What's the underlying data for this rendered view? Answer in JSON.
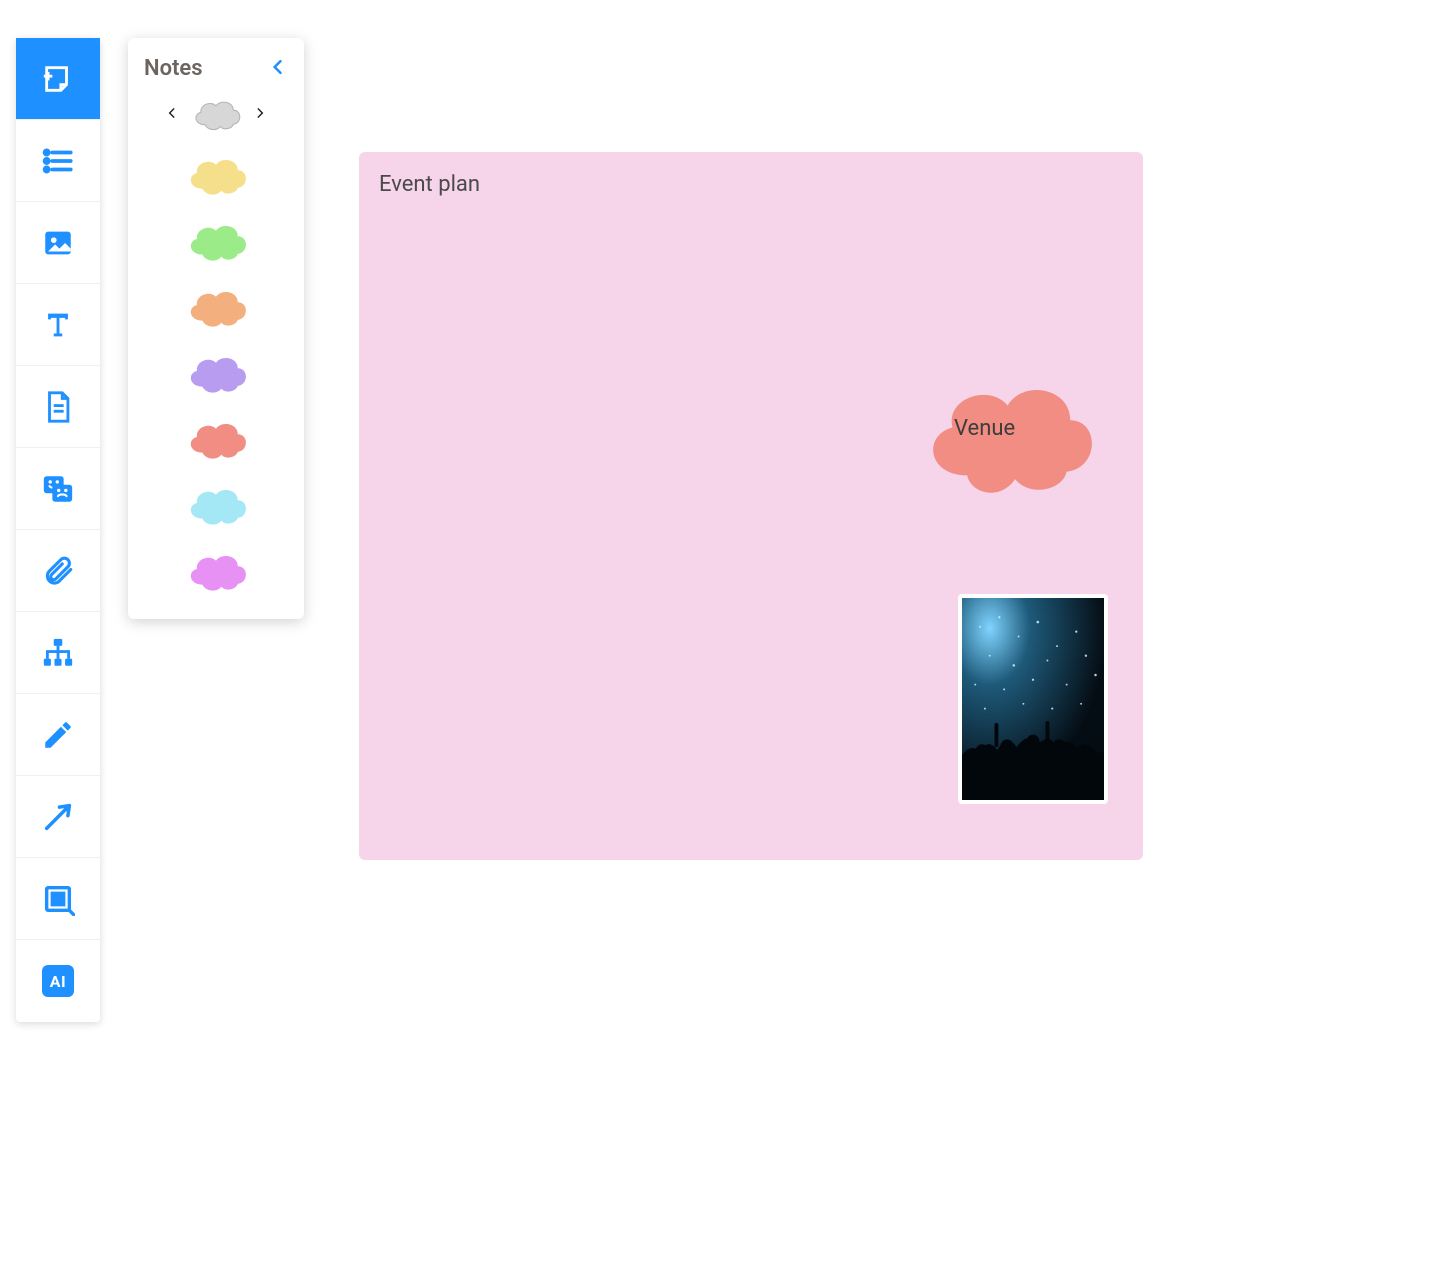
{
  "toolbar": {
    "items": [
      {
        "name": "add-note",
        "active": true
      },
      {
        "name": "list",
        "active": false
      },
      {
        "name": "image",
        "active": false
      },
      {
        "name": "text",
        "active": false
      },
      {
        "name": "document",
        "active": false
      },
      {
        "name": "emoji",
        "active": false
      },
      {
        "name": "attachment",
        "active": false
      },
      {
        "name": "sitemap",
        "active": false
      },
      {
        "name": "pencil",
        "active": false
      },
      {
        "name": "arrow",
        "active": false
      },
      {
        "name": "frame",
        "active": false
      },
      {
        "name": "ai",
        "active": false
      }
    ],
    "ai_label": "AI"
  },
  "notes_panel": {
    "title": "Notes",
    "shape": "cloud",
    "preview_color": "#d7d7d7",
    "swatches": [
      {
        "name": "yellow",
        "color": "#f5df8a"
      },
      {
        "name": "green",
        "color": "#9ceb89"
      },
      {
        "name": "orange",
        "color": "#f3b07e"
      },
      {
        "name": "purple",
        "color": "#b79cf0"
      },
      {
        "name": "coral",
        "color": "#f18d83"
      },
      {
        "name": "cyan",
        "color": "#a4e8f6"
      },
      {
        "name": "pink",
        "color": "#e791f4"
      }
    ]
  },
  "board": {
    "note_color": "#f6d4ea",
    "note_title": "Event plan",
    "cloud_color": "#f18d83",
    "cloud_label": "Venue",
    "image_alt": "concert-crowd-photo"
  }
}
